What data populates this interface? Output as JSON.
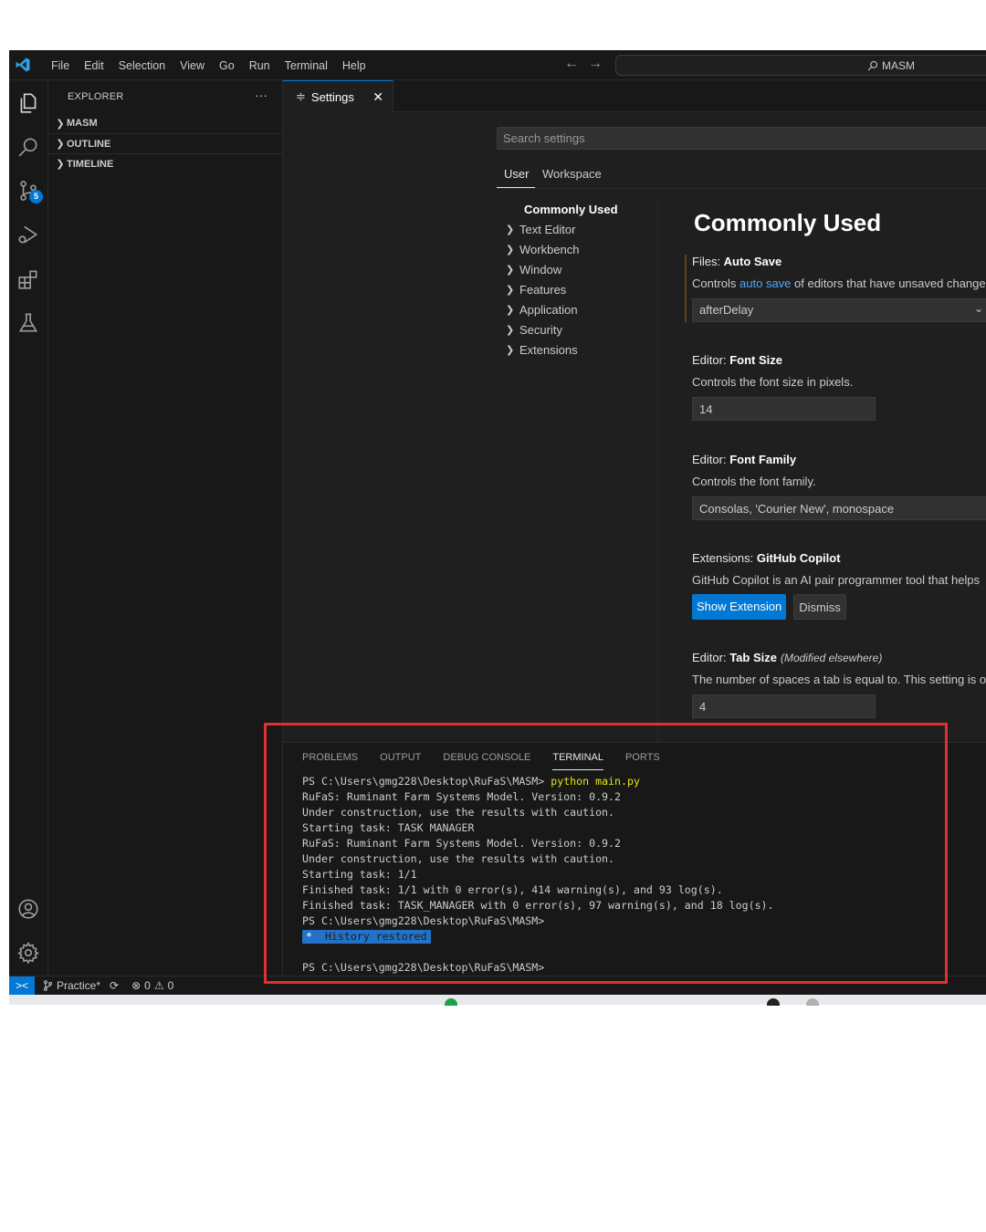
{
  "menu": [
    "File",
    "Edit",
    "Selection",
    "View",
    "Go",
    "Run",
    "Terminal",
    "Help"
  ],
  "command_center": {
    "text": "MASM"
  },
  "nav": {
    "back": "←",
    "forward": "→"
  },
  "activity": {
    "scm_badge": "5"
  },
  "sidebar": {
    "title": "EXPLORER",
    "more": "···",
    "sections": [
      "MASM",
      "OUTLINE",
      "TIMELINE"
    ]
  },
  "tab": {
    "icon": "≑",
    "label": "Settings",
    "close": "✕"
  },
  "settings": {
    "search_placeholder": "Search settings",
    "scopes": [
      "User",
      "Workspace"
    ],
    "toc": [
      "Commonly Used",
      "Text Editor",
      "Workbench",
      "Window",
      "Features",
      "Application",
      "Security",
      "Extensions"
    ],
    "heading": "Commonly Used",
    "autosave": {
      "category": "Files: ",
      "name": "Auto Save",
      "desc_before": "Controls ",
      "desc_link": "auto save",
      "desc_after": " of editors that have unsaved changes",
      "value": "afterDelay"
    },
    "fontsize": {
      "category": "Editor: ",
      "name": "Font Size",
      "desc": "Controls the font size in pixels.",
      "value": "14"
    },
    "fontfamily": {
      "category": "Editor: ",
      "name": "Font Family",
      "desc": "Controls the font family.",
      "value": "Consolas, 'Courier New', monospace"
    },
    "copilot": {
      "category": "Extensions: ",
      "name": "GitHub Copilot",
      "desc": "GitHub Copilot is an AI pair programmer tool that helps",
      "show_button": "Show Extension",
      "dismiss_button": "Dismiss"
    },
    "tabsize": {
      "category": "Editor: ",
      "name": "Tab Size",
      "note": "(Modified elsewhere)",
      "desc": "The number of spaces a tab is equal to. This setting is ov",
      "value": "4"
    }
  },
  "panel": {
    "tabs": [
      "PROBLEMS",
      "OUTPUT",
      "DEBUG CONSOLE",
      "TERMINAL",
      "PORTS"
    ],
    "active_tab": "TERMINAL",
    "terminal": {
      "prompt1": "PS C:\\Users\\gmg228\\Desktop\\RuFaS\\MASM> ",
      "command": "python main.py",
      "lines": [
        "RuFaS: Ruminant Farm Systems Model. Version: 0.9.2",
        "Under construction, use the results with caution.",
        "Starting task: TASK MANAGER",
        "RuFaS: Ruminant Farm Systems Model. Version: 0.9.2",
        "Under construction, use the results with caution.",
        "Starting task: 1/1",
        "Finished task: 1/1 with 0 error(s), 414 warning(s), and 93 log(s).",
        "Finished task: TASK_MANAGER with 0 error(s), 97 warning(s), and 18 log(s).",
        "PS C:\\Users\\gmg228\\Desktop\\RuFaS\\MASM>"
      ],
      "restored_star": "*",
      "restored_text": "History restored",
      "prompt2": "PS C:\\Users\\gmg228\\Desktop\\RuFaS\\MASM>"
    }
  },
  "statusbar": {
    "remote": "><",
    "branch": "Practice*",
    "sync": "⟳",
    "errors": "0",
    "warnings": "0"
  },
  "colors": {
    "accent": "#0078d4",
    "highlight_box": "#e0312e",
    "link": "#4daafc",
    "terminal_command": "#e5e510"
  }
}
